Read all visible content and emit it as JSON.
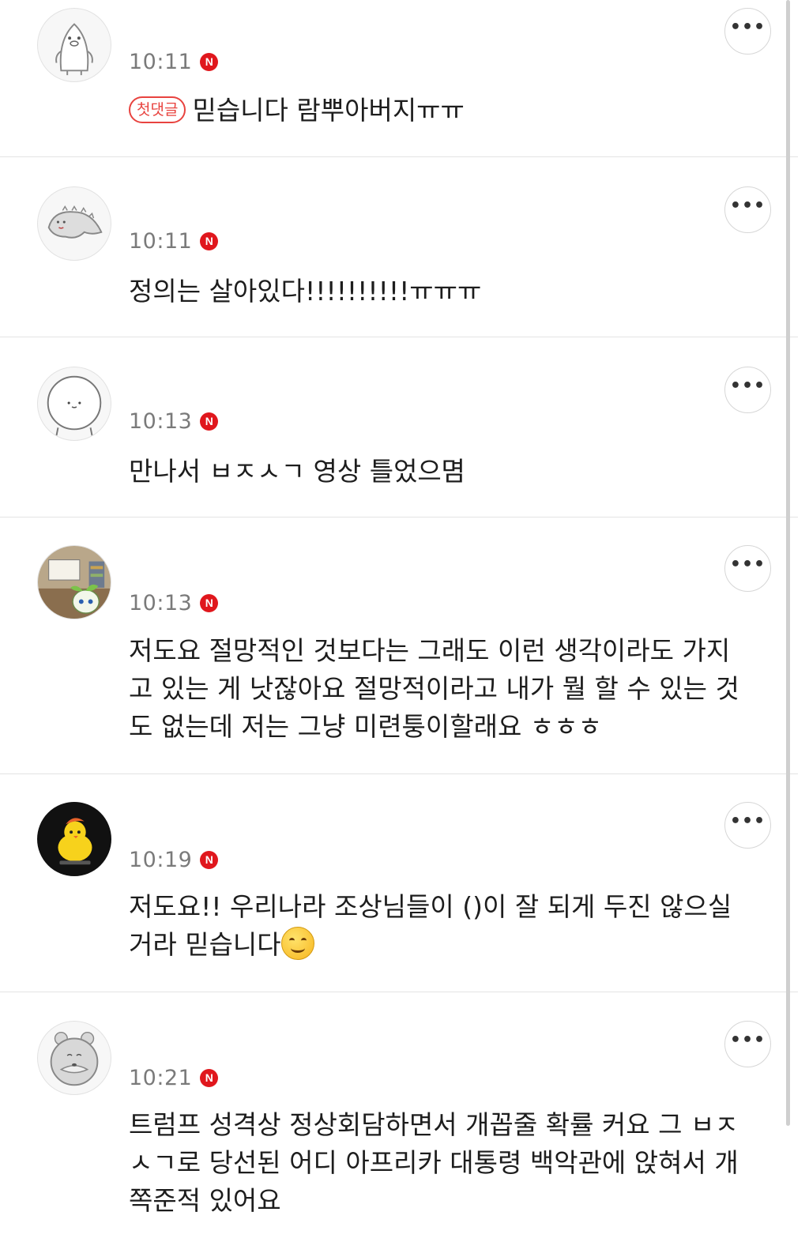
{
  "comments": [
    {
      "avatar": "penguin-avatar",
      "time": "10:11",
      "badge": "N",
      "first_comment_label": "첫댓글",
      "text": "믿습니다 람뿌아버지ㅠㅠ",
      "more_label": "•••"
    },
    {
      "avatar": "lizard-avatar",
      "time": "10:11",
      "badge": "N",
      "text": "정의는 살아있다!!!!!!!!!!ㅠㅠㅠ",
      "more_label": "•••"
    },
    {
      "avatar": "round-face-avatar",
      "time": "10:13",
      "badge": "N",
      "text": "만나서 ㅂㅈㅅㄱ 영상 틀었으몀",
      "more_label": "•••"
    },
    {
      "avatar": "sprout-character-avatar",
      "time": "10:13",
      "badge": "N",
      "text": "저도요 절망적인 것보다는 그래도 이런 생각이라도 가지고 있는 게 낫잖아요 절망적이라고 내가 뭘 할 수 있는 것도 없는데 저는 그냥 미련퉁이할래요 ㅎㅎㅎ",
      "more_label": "•••"
    },
    {
      "avatar": "chick-avatar",
      "time": "10:19",
      "badge": "N",
      "text": "저도요!! 우리나라 조상님들이 ()이 잘 되게 두진 않으실거라 믿습니다",
      "emoji": "smiling-face-emoji",
      "more_label": "•••"
    },
    {
      "avatar": "bear-avatar",
      "time": "10:21",
      "badge": "N",
      "text": "트럼프 성격상 정상회담하면서 개꼽줄 확률 커요 그 ㅂㅈㅅㄱ로 당선된 어디 아프리카 대통령 백악관에 앉혀서 개쪽준적 있어요",
      "more_label": "•••"
    }
  ],
  "colors": {
    "badge_red": "#e0171d",
    "first_badge_red": "#e8433f",
    "time_gray": "#7a7a7a",
    "text": "#1d1d1d",
    "divider": "#e3e3e3"
  }
}
